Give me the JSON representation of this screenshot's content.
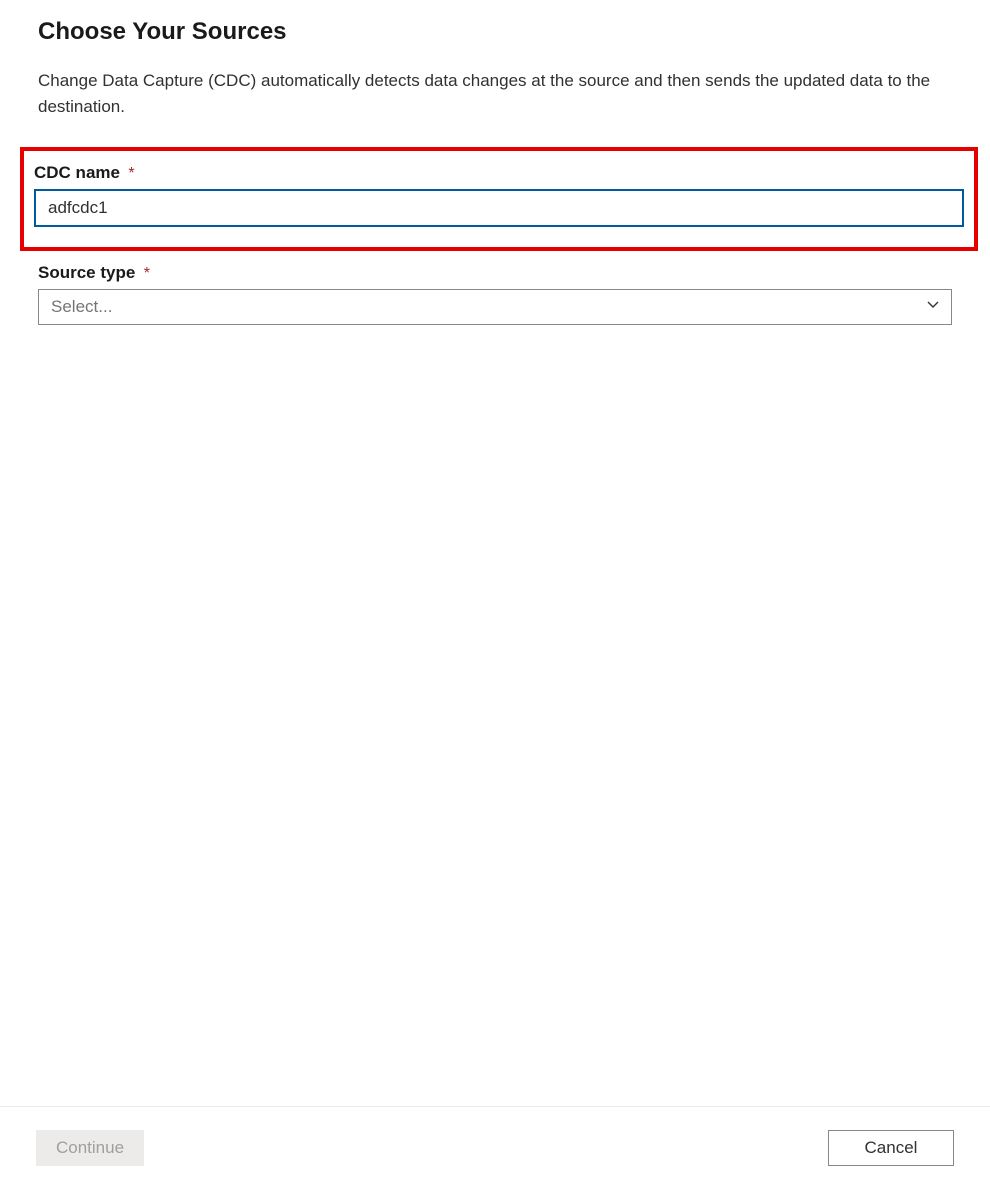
{
  "header": {
    "title": "Choose Your Sources",
    "description": "Change Data Capture (CDC) automatically detects data changes at the source and then sends the updated data to the destination."
  },
  "form": {
    "cdc_name": {
      "label": "CDC name",
      "required_marker": "*",
      "value": "adfcdc1"
    },
    "source_type": {
      "label": "Source type",
      "required_marker": "*",
      "placeholder": "Select..."
    }
  },
  "footer": {
    "continue_label": "Continue",
    "cancel_label": "Cancel"
  }
}
